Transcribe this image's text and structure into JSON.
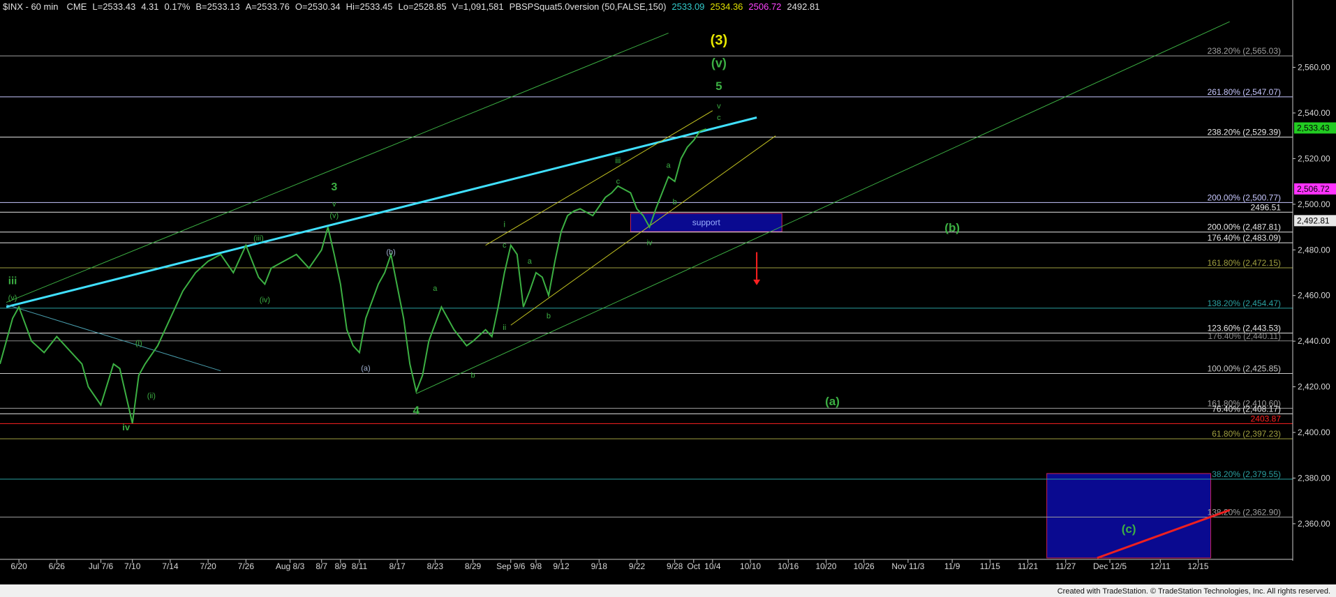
{
  "header": {
    "symbol": "$INX - 60 min",
    "exchange": "CME",
    "fields": [
      "L=2533.43",
      "4.31",
      "0.17%",
      "B=2533.13",
      "A=2533.76",
      "O=2530.34",
      "Hi=2533.45",
      "Lo=2528.85",
      "V=1,091,581",
      "PBSPSquat5.0version (50,FALSE,150)",
      "2533.09",
      "2534.36",
      "2506.72",
      "2492.81"
    ],
    "field_colors": [
      "#e0e0e0",
      "#e0e0e0",
      "#e0e0e0",
      "#e0e0e0",
      "#e0e0e0",
      "#e0e0e0",
      "#e0e0e0",
      "#e0e0e0",
      "#e0e0e0",
      "#e0e0e0",
      "#33cccc",
      "#e0e000",
      "#ff44ff",
      "#e0e0e0"
    ]
  },
  "footer": {
    "credit": "Created with TradeStation. © TradeStation Technologies, Inc. All rights reserved."
  },
  "chart_data": {
    "type": "line",
    "title": "$INX - 60 min",
    "ylim": [
      2345,
      2584
    ],
    "xlim": [
      0,
      205
    ],
    "y_ticks": [
      2360,
      2380,
      2400,
      2420,
      2440,
      2460,
      2480,
      2500,
      2520,
      2540,
      2560
    ],
    "y_tick_labels": [
      "2,360.00",
      "2,380.00",
      "2,400.00",
      "2,420.00",
      "2,440.00",
      "2,460.00",
      "2,480.00",
      "2,500.00",
      "2,520.00",
      "2,540.00",
      "2,560.00"
    ],
    "x_ticks": [
      {
        "label": "6/20",
        "x": 3
      },
      {
        "label": "6/26",
        "x": 9
      },
      {
        "label": "Jul 7/6",
        "x": 16
      },
      {
        "label": "7/10",
        "x": 21
      },
      {
        "label": "7/14",
        "x": 27
      },
      {
        "label": "7/20",
        "x": 33
      },
      {
        "label": "7/26",
        "x": 39
      },
      {
        "label": "Aug 8/3",
        "x": 46
      },
      {
        "label": "8/7",
        "x": 51
      },
      {
        "label": "8/9",
        "x": 54
      },
      {
        "label": "8/11",
        "x": 57
      },
      {
        "label": "8/17",
        "x": 63
      },
      {
        "label": "8/23",
        "x": 69
      },
      {
        "label": "8/29",
        "x": 75
      },
      {
        "label": "Sep 9/6",
        "x": 81
      },
      {
        "label": "9/8",
        "x": 85
      },
      {
        "label": "9/12",
        "x": 89
      },
      {
        "label": "9/18",
        "x": 95
      },
      {
        "label": "9/22",
        "x": 101
      },
      {
        "label": "9/28",
        "x": 107
      },
      {
        "label": "Oct",
        "x": 110
      },
      {
        "label": "10/4",
        "x": 113
      },
      {
        "label": "10/10",
        "x": 119
      },
      {
        "label": "10/16",
        "x": 125
      },
      {
        "label": "10/20",
        "x": 131
      },
      {
        "label": "10/26",
        "x": 137
      },
      {
        "label": "Nov 11/3",
        "x": 144
      },
      {
        "label": "11/9",
        "x": 151
      },
      {
        "label": "11/15",
        "x": 157
      },
      {
        "label": "11/21",
        "x": 163
      },
      {
        "label": "11/27",
        "x": 169
      },
      {
        "label": "Dec 12/5",
        "x": 176
      },
      {
        "label": "12/11",
        "x": 184
      },
      {
        "label": "12/15",
        "x": 190
      }
    ],
    "series": [
      {
        "color": "#3cb043",
        "x": [
          0,
          2,
          3,
          5,
          7,
          9,
          11,
          13,
          14,
          16,
          18,
          19,
          21,
          22,
          23,
          25,
          27,
          29,
          31,
          33,
          35,
          37,
          39,
          41,
          42,
          43,
          45,
          47,
          49,
          51,
          52,
          53,
          54,
          55,
          56,
          57,
          58,
          60,
          61,
          62,
          64,
          65,
          66,
          67,
          68,
          70,
          72,
          74,
          75,
          77,
          78,
          79,
          80,
          81,
          82,
          83,
          84,
          85,
          86,
          87,
          88,
          89,
          90,
          91,
          92,
          94,
          96,
          97,
          98,
          100,
          101,
          102,
          103,
          104,
          105,
          106,
          107,
          108,
          109,
          110,
          111,
          112
        ],
        "values": [
          2430,
          2450,
          2455,
          2440,
          2435,
          2442,
          2436,
          2430,
          2420,
          2412,
          2430,
          2428,
          2404,
          2425,
          2430,
          2438,
          2450,
          2462,
          2470,
          2475,
          2478,
          2470,
          2482,
          2468,
          2465,
          2472,
          2475,
          2478,
          2472,
          2480,
          2490,
          2478,
          2465,
          2445,
          2438,
          2435,
          2450,
          2465,
          2470,
          2478,
          2450,
          2430,
          2418,
          2425,
          2440,
          2455,
          2445,
          2438,
          2440,
          2445,
          2442,
          2455,
          2470,
          2482,
          2478,
          2455,
          2462,
          2470,
          2468,
          2460,
          2475,
          2488,
          2495,
          2497,
          2498,
          2495,
          2503,
          2505,
          2508,
          2505,
          2498,
          2495,
          2490,
          2498,
          2505,
          2512,
          2510,
          2520,
          2525,
          2528,
          2532,
          2533
        ]
      }
    ],
    "fib_levels": [
      {
        "label": "238.20% (2,565.03)",
        "value": 2565.03,
        "color": "#a0a0a0"
      },
      {
        "label": "261.80% (2,547.07)",
        "value": 2547.07,
        "color": "#c8c8ff"
      },
      {
        "label": "238.20% (2,529.39)",
        "value": 2529.39,
        "color": "#e8e8e8"
      },
      {
        "label": "200.00% (2,500.77)",
        "value": 2500.77,
        "color": "#c8c8ff"
      },
      {
        "label": "2496.51",
        "value": 2496.51,
        "color": "#e8e8e8"
      },
      {
        "label": "200.00% (2,487.81)",
        "value": 2487.81,
        "color": "#e8e8e8"
      },
      {
        "label": "176.40% (2,483.09)",
        "value": 2483.09,
        "color": "#e8e8e8"
      },
      {
        "label": "161.80% (2,472.15)",
        "value": 2472.15,
        "color": "#a0a040"
      },
      {
        "label": "138.20% (2,454.47)",
        "value": 2454.47,
        "color": "#2aa0a0"
      },
      {
        "label": "123.60% (2,443.53)",
        "value": 2443.53,
        "color": "#e8e8e8"
      },
      {
        "label": "176.40% (2,440.11)",
        "value": 2440.11,
        "color": "#888888"
      },
      {
        "label": "100.00% (2,425.85)",
        "value": 2425.85,
        "color": "#c8c8c8"
      },
      {
        "label": "161.80% (2,410.60)",
        "value": 2410.6,
        "color": "#a0a0a0"
      },
      {
        "label": "76.40% (2,408.17)",
        "value": 2408.17,
        "color": "#e8e8e8"
      },
      {
        "label": "2403.87",
        "value": 2403.87,
        "color": "#ff2020"
      },
      {
        "label": "61.80% (2,397.23)",
        "value": 2397.23,
        "color": "#a0a040"
      },
      {
        "label": "38.20% (2,379.55)",
        "value": 2379.55,
        "color": "#2aa0a0"
      },
      {
        "label": "138.20% (2,362.90)",
        "value": 2362.9,
        "color": "#a0a0a0"
      }
    ],
    "price_tags": [
      {
        "label": "2,533.43",
        "value": 2533.43,
        "bg": "#22cc22",
        "fg": "#000000"
      },
      {
        "label": "2,506.72",
        "value": 2506.72,
        "bg": "#ff33ff",
        "fg": "#000000"
      },
      {
        "label": "2,492.81",
        "value": 2492.81,
        "bg": "#e8e8e8",
        "fg": "#000000"
      }
    ],
    "trendlines": [
      {
        "x1": 1,
        "y1": 2455,
        "x2": 120,
        "y2": 2538,
        "color": "#40e0ff",
        "width": 3
      },
      {
        "x1": 1,
        "y1": 2457,
        "x2": 106,
        "y2": 2575,
        "color": "#3cb043",
        "width": 1
      },
      {
        "x1": 66,
        "y1": 2417,
        "x2": 195,
        "y2": 2580,
        "color": "#3cb043",
        "width": 1
      },
      {
        "x1": 1,
        "y1": 2456,
        "x2": 35,
        "y2": 2427,
        "color": "#4aa0b0",
        "width": 1
      },
      {
        "x1": 77,
        "y1": 2482,
        "x2": 113,
        "y2": 2541,
        "color": "#c0c020",
        "width": 1
      },
      {
        "x1": 81,
        "y1": 2447,
        "x2": 123,
        "y2": 2530,
        "color": "#c0c020",
        "width": 1
      },
      {
        "x1": 174,
        "y1": 2345,
        "x2": 195,
        "y2": 2366,
        "color": "#ee2020",
        "width": 3
      }
    ],
    "boxes": [
      {
        "label": "support",
        "x1": 100,
        "x2": 124,
        "y1": 2488,
        "y2": 2496,
        "fill": "#0a0a90",
        "stroke": "#cc2255"
      },
      {
        "label": "",
        "x1": 166,
        "x2": 192,
        "y1": 2345,
        "y2": 2382,
        "fill": "#0a0a90",
        "stroke": "#cc2255"
      }
    ],
    "wave_labels": [
      {
        "text": "(3)",
        "x": 114,
        "y": 2570,
        "color": "#e8e800",
        "size": 20,
        "weight": "bold"
      },
      {
        "text": "(v)",
        "x": 114,
        "y": 2560,
        "color": "#3cb043",
        "size": 18,
        "weight": "bold"
      },
      {
        "text": "5",
        "x": 114,
        "y": 2550,
        "color": "#3cb043",
        "size": 17,
        "weight": "bold"
      },
      {
        "text": "v",
        "x": 114,
        "y": 2542,
        "color": "#3cb043",
        "size": 11,
        "weight": "normal"
      },
      {
        "text": "c",
        "x": 114,
        "y": 2537,
        "color": "#3cb043",
        "size": 11,
        "weight": "normal"
      },
      {
        "text": "iii",
        "x": 2,
        "y": 2465,
        "color": "#3cb043",
        "size": 15,
        "weight": "bold"
      },
      {
        "text": "(v)",
        "x": 2,
        "y": 2458,
        "color": "#3cb043",
        "size": 11,
        "weight": "normal"
      },
      {
        "text": "iv",
        "x": 20,
        "y": 2401,
        "color": "#3cb043",
        "size": 13,
        "weight": "bold"
      },
      {
        "text": "(i)",
        "x": 22,
        "y": 2438,
        "color": "#3cb043",
        "size": 11,
        "weight": "normal"
      },
      {
        "text": "(ii)",
        "x": 24,
        "y": 2415,
        "color": "#3cb043",
        "size": 11,
        "weight": "normal"
      },
      {
        "text": "(iii)",
        "x": 41,
        "y": 2484,
        "color": "#3cb043",
        "size": 11,
        "weight": "normal"
      },
      {
        "text": "(iv)",
        "x": 42,
        "y": 2457,
        "color": "#3cb043",
        "size": 11,
        "weight": "normal"
      },
      {
        "text": "3",
        "x": 53,
        "y": 2506,
        "color": "#3cb043",
        "size": 16,
        "weight": "bold"
      },
      {
        "text": "v",
        "x": 53,
        "y": 2499,
        "color": "#3cb043",
        "size": 11,
        "weight": "normal"
      },
      {
        "text": "(v)",
        "x": 53,
        "y": 2494,
        "color": "#3cb043",
        "size": 11,
        "weight": "normal"
      },
      {
        "text": "(b)",
        "x": 62,
        "y": 2478,
        "color": "#a0b0d0",
        "size": 11,
        "weight": "normal"
      },
      {
        "text": "(a)",
        "x": 58,
        "y": 2427,
        "color": "#a0b0d0",
        "size": 11,
        "weight": "normal"
      },
      {
        "text": "4",
        "x": 66,
        "y": 2408,
        "color": "#3cb043",
        "size": 17,
        "weight": "bold"
      },
      {
        "text": "a",
        "x": 69,
        "y": 2462,
        "color": "#3cb043",
        "size": 11,
        "weight": "normal"
      },
      {
        "text": "b",
        "x": 75,
        "y": 2424,
        "color": "#3cb043",
        "size": 11,
        "weight": "normal"
      },
      {
        "text": "i",
        "x": 80,
        "y": 2490,
        "color": "#3cb043",
        "size": 12,
        "weight": "normal"
      },
      {
        "text": "c",
        "x": 80,
        "y": 2481,
        "color": "#3cb043",
        "size": 11,
        "weight": "normal"
      },
      {
        "text": "a",
        "x": 84,
        "y": 2474,
        "color": "#3cb043",
        "size": 11,
        "weight": "normal"
      },
      {
        "text": "ii",
        "x": 80,
        "y": 2445,
        "color": "#3cb043",
        "size": 11,
        "weight": "normal"
      },
      {
        "text": "b",
        "x": 87,
        "y": 2450,
        "color": "#3cb043",
        "size": 11,
        "weight": "normal"
      },
      {
        "text": "iii",
        "x": 98,
        "y": 2518,
        "color": "#3cb043",
        "size": 12,
        "weight": "normal"
      },
      {
        "text": "c",
        "x": 98,
        "y": 2509,
        "color": "#3cb043",
        "size": 11,
        "weight": "normal"
      },
      {
        "text": "a",
        "x": 106,
        "y": 2516,
        "color": "#3cb043",
        "size": 11,
        "weight": "normal"
      },
      {
        "text": "b",
        "x": 107,
        "y": 2500,
        "color": "#3cb043",
        "size": 11,
        "weight": "normal"
      },
      {
        "text": "iv",
        "x": 103,
        "y": 2482,
        "color": "#3cb043",
        "size": 11,
        "weight": "normal"
      },
      {
        "text": "(b)",
        "x": 151,
        "y": 2488,
        "color": "#3cb043",
        "size": 17,
        "weight": "bold"
      },
      {
        "text": "(a)",
        "x": 132,
        "y": 2412,
        "color": "#3cb043",
        "size": 17,
        "weight": "bold"
      },
      {
        "text": "(c)",
        "x": 179,
        "y": 2356,
        "color": "#3cb043",
        "size": 17,
        "weight": "bold"
      }
    ],
    "arrow": {
      "x": 120,
      "y1": 2479,
      "y2": 2467,
      "color": "#ff2020"
    }
  }
}
